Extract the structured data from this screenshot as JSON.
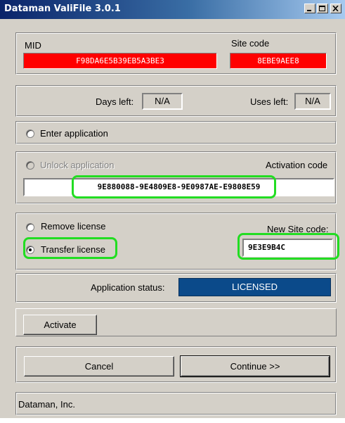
{
  "window": {
    "title": "Dataman ValiFile 3.0.1"
  },
  "ids": {
    "mid_label": "MID",
    "mid_value": "F98DA6E5B39EB5A3BE3",
    "site_label": "Site code",
    "site_value": "8EBE9AEE8"
  },
  "counters": {
    "days_label": "Days left:",
    "days_value": "N/A",
    "uses_label": "Uses left:",
    "uses_value": "N/A"
  },
  "enter": {
    "label": "Enter application"
  },
  "unlock": {
    "label": "Unlock application",
    "activation_label": "Activation code",
    "activation_value": "9E880088-9E4809E8-9E0987AE-E9808E59"
  },
  "license": {
    "remove_label": "Remove license",
    "transfer_label": "Transfer license",
    "new_site_label": "New Site code:",
    "new_site_value": "9E3E9B4C"
  },
  "status": {
    "label": "Application status:",
    "value": "LICENSED",
    "color": "#0b4a8a"
  },
  "actions": {
    "activate": "Activate",
    "cancel": "Cancel",
    "continue": "Continue >>"
  },
  "footer": {
    "company": "Dataman, Inc."
  },
  "highlight_color": "#22dd22"
}
